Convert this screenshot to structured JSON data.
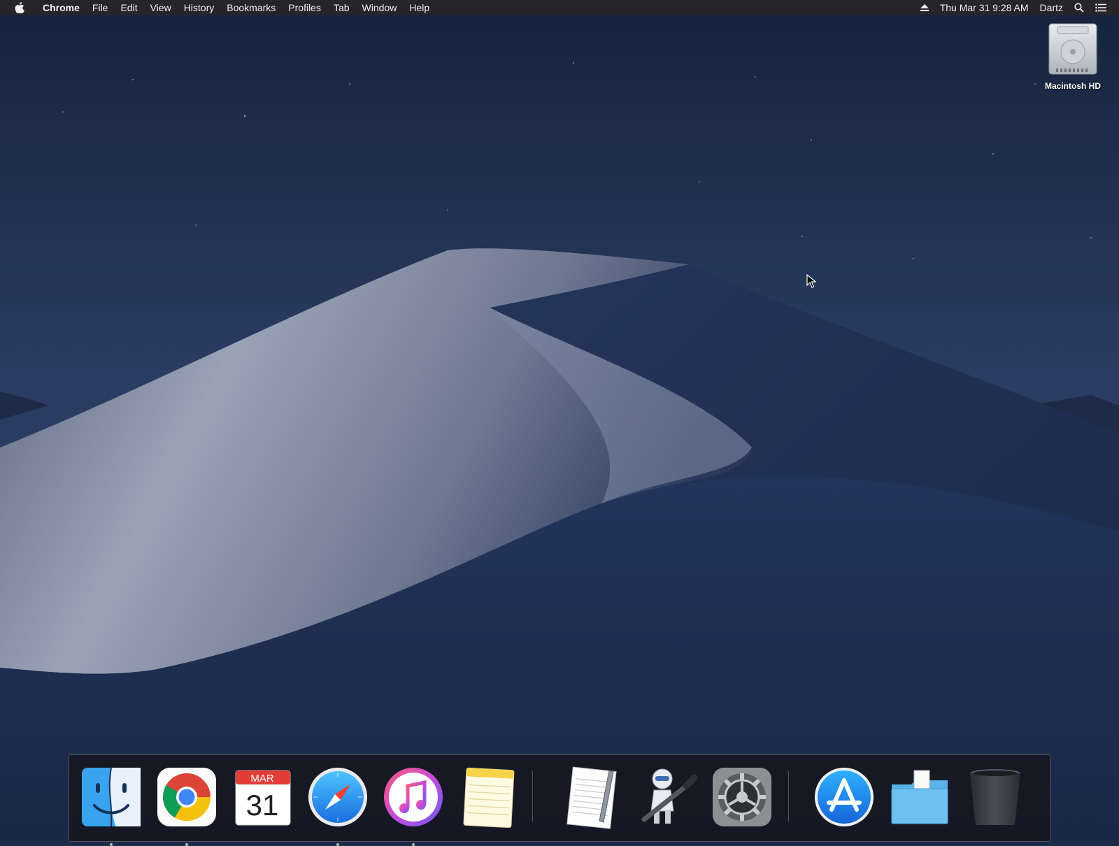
{
  "menubar": {
    "app_name": "Chrome",
    "items": [
      "File",
      "Edit",
      "View",
      "History",
      "Bookmarks",
      "Profiles",
      "Tab",
      "Window",
      "Help"
    ],
    "datetime": "Thu Mar 31  9:28 AM",
    "user": "Dartz"
  },
  "desktop": {
    "disk_label": "Macintosh HD"
  },
  "dock": {
    "calendar_month": "MAR",
    "calendar_day": "31",
    "items": [
      {
        "icon": "finder-icon",
        "running": true
      },
      {
        "icon": "chrome-icon",
        "running": true
      },
      {
        "icon": "calendar-icon",
        "running": false
      },
      {
        "icon": "safari-icon",
        "running": true
      },
      {
        "icon": "itunes-icon",
        "running": true
      },
      {
        "icon": "notes-icon",
        "running": false
      },
      {
        "icon": "textedit-icon",
        "running": false
      },
      {
        "icon": "automator-icon",
        "running": false
      },
      {
        "icon": "system-preferences-icon",
        "running": false
      },
      {
        "icon": "app-store-icon",
        "running": false
      },
      {
        "icon": "downloads-folder-icon",
        "running": false
      },
      {
        "icon": "trash-icon",
        "running": false
      }
    ]
  },
  "colors": {
    "menubar_bg": "#25252a",
    "sky": "#1b2b4a",
    "dune_light": "#8a93a8"
  }
}
